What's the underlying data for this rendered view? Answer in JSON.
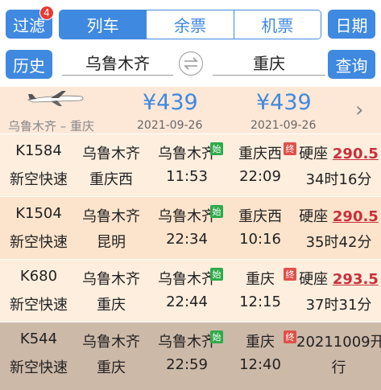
{
  "toolbar": {
    "filter_label": "过滤",
    "filter_badge": "4",
    "tabs": [
      {
        "label": "列车",
        "active": true
      },
      {
        "label": "余票",
        "active": false
      },
      {
        "label": "机票",
        "active": false
      }
    ],
    "date_label": "日期"
  },
  "search": {
    "history_label": "历史",
    "from_station": "乌鲁木齐",
    "to_station": "重庆",
    "query_label": "查询"
  },
  "flight": {
    "route": "乌鲁木齐 – 重庆",
    "options": [
      {
        "price": "¥439",
        "date": "2021-09-26"
      },
      {
        "price": "¥439",
        "date": "2021-09-26"
      }
    ]
  },
  "trains": [
    {
      "number": "K1584",
      "type": "新空快速",
      "from": "乌鲁木齐",
      "to": "重庆西",
      "dep_station": "乌鲁木齐",
      "dep_time": "11:53",
      "dep_tag": "始",
      "arr_station": "重庆西",
      "arr_time": "22:09",
      "arr_tag": "终",
      "seat": "硬座",
      "price": "290.5",
      "duration": "34时16分",
      "bg": "#fdeede"
    },
    {
      "number": "K1504",
      "type": "新空快速",
      "from": "乌鲁木齐",
      "to": "昆明",
      "dep_station": "乌鲁木齐",
      "dep_time": "22:34",
      "dep_tag": "始",
      "arr_station": "重庆西",
      "arr_time": "10:16",
      "arr_tag": "",
      "seat": "硬座",
      "price": "290.5",
      "duration": "35时42分",
      "bg": "#fce4cc"
    },
    {
      "number": "K680",
      "type": "新空快速",
      "from": "乌鲁木齐",
      "to": "重庆",
      "dep_station": "乌鲁木齐",
      "dep_time": "22:44",
      "dep_tag": "始",
      "arr_station": "重庆",
      "arr_time": "12:15",
      "arr_tag": "终",
      "seat": "硬座",
      "price": "293.5",
      "duration": "37时31分",
      "bg": "#fdeede"
    },
    {
      "number": "K544",
      "type": "新空快速",
      "from": "乌鲁木齐",
      "to": "重庆",
      "dep_station": "乌鲁木齐",
      "dep_time": "22:59",
      "dep_tag": "始",
      "arr_station": "重庆",
      "arr_time": "12:40",
      "arr_tag": "终",
      "seat_note": "20211009开",
      "seat_note2": "行",
      "bg": "#cdb9a8"
    }
  ]
}
